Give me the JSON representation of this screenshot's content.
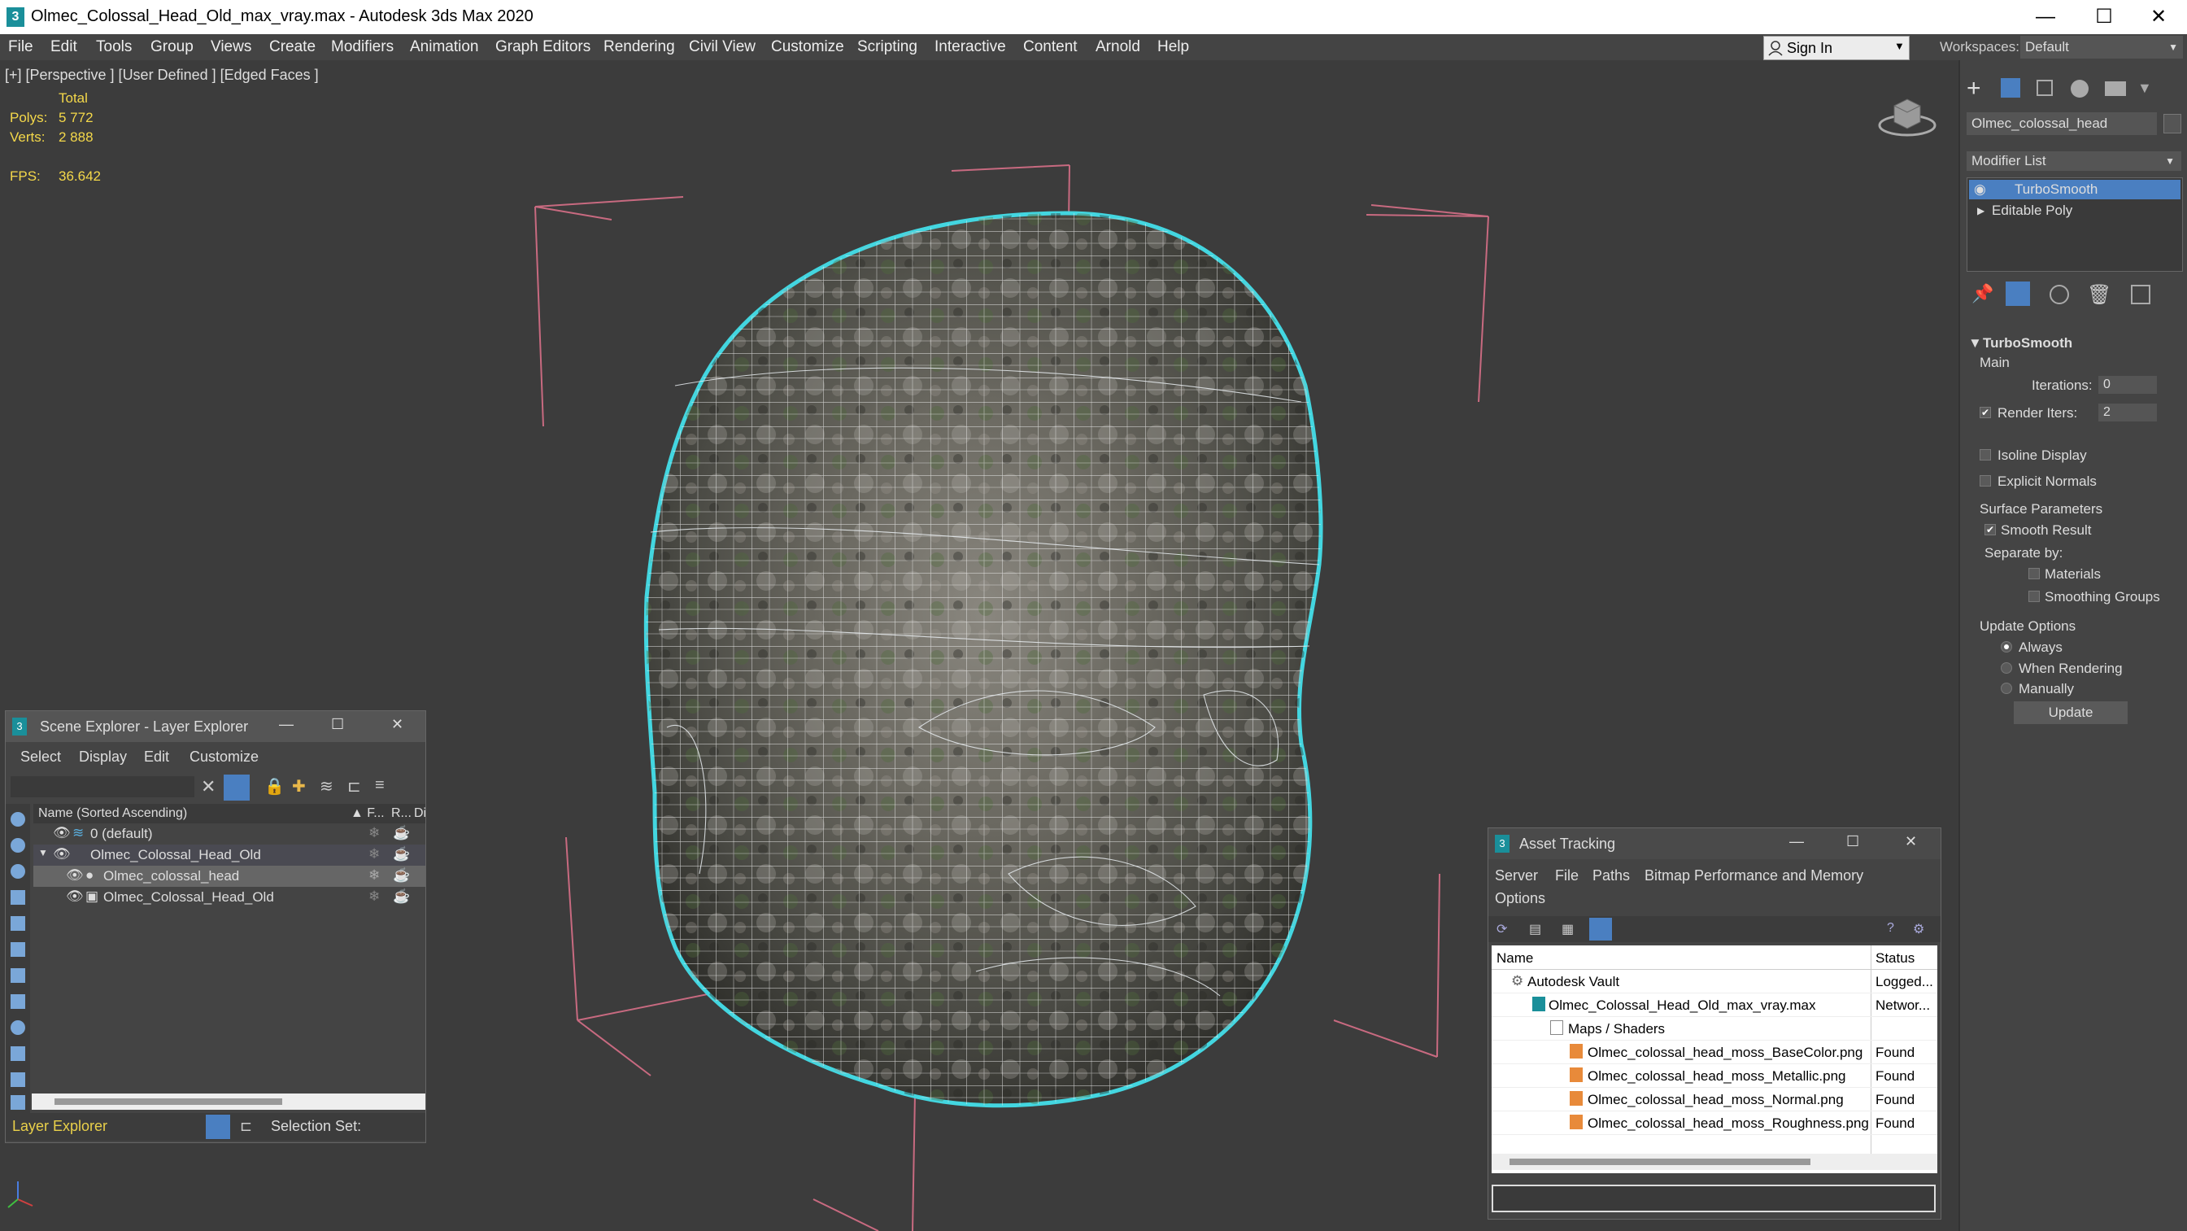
{
  "window": {
    "title": "Olmec_Colossal_Head_Old_max_vray.max - Autodesk 3ds Max 2020",
    "app_icon": "3",
    "minimize_glyph": "—",
    "maximize_glyph": "☐",
    "close_glyph": "✕"
  },
  "menu": [
    "File",
    "Edit",
    "Tools",
    "Group",
    "Views",
    "Create",
    "Modifiers",
    "Animation",
    "Graph Editors",
    "Rendering",
    "Civil View",
    "Customize",
    "Scripting",
    "Interactive",
    "Content",
    "Arnold",
    "Help"
  ],
  "signin": {
    "label": "Sign In"
  },
  "workspaces": {
    "label": "Workspaces:",
    "value": "Default"
  },
  "viewport": {
    "label": "[+] [Perspective ] [User Defined ] [Edged Faces ]",
    "stats": {
      "total_label": "Total",
      "polys_label": "Polys:",
      "polys_value": "5 772",
      "verts_label": "Verts:",
      "verts_value": "2 888",
      "fps_label": "FPS:",
      "fps_value": "36.642"
    }
  },
  "command_panel": {
    "object_name": "Olmec_colossal_head",
    "modifier_list_label": "Modifier List",
    "stack": [
      "TurboSmooth",
      "Editable Poly"
    ],
    "rollout_title": "TurboSmooth",
    "main_label": "Main",
    "iterations_label": "Iterations:",
    "iterations_value": "0",
    "render_iters_label": "Render Iters:",
    "render_iters_value": "2",
    "isoline_label": "Isoline Display",
    "explicit_normals_label": "Explicit Normals",
    "surface_params_label": "Surface Parameters",
    "smooth_result_label": "Smooth Result",
    "separate_by_label": "Separate by:",
    "materials_label": "Materials",
    "smoothing_groups_label": "Smoothing Groups",
    "update_options_label": "Update Options",
    "always_label": "Always",
    "when_rendering_label": "When Rendering",
    "manually_label": "Manually",
    "update_button": "Update",
    "selection_color": "#4a7fc1"
  },
  "scene_explorer": {
    "title": "Scene Explorer - Layer Explorer",
    "menus": [
      "Select",
      "Display",
      "Edit",
      "Customize"
    ],
    "col_name": "Name (Sorted Ascending)",
    "col_f": "▲ F...",
    "col_r": "R...",
    "col_d": "Di",
    "rows": [
      "0 (default)",
      "Olmec_Colossal_Head_Old",
      "Olmec_colossal_head",
      "Olmec_Colossal_Head_Old"
    ],
    "footer_dropdown": "Layer Explorer",
    "selection_set_label": "Selection Set:"
  },
  "asset_tracking": {
    "title": "Asset Tracking",
    "menus": [
      "Server",
      "File",
      "Paths",
      "Bitmap Performance and Memory"
    ],
    "menu_options": "Options",
    "col_name": "Name",
    "col_status": "Status",
    "rows": [
      {
        "name": "Autodesk Vault",
        "status": "Logged..."
      },
      {
        "name": "Olmec_Colossal_Head_Old_max_vray.max",
        "status": "Networ..."
      },
      {
        "name": "Maps / Shaders",
        "status": ""
      },
      {
        "name": "Olmec_colossal_head_moss_BaseColor.png",
        "status": "Found"
      },
      {
        "name": "Olmec_colossal_head_moss_Metallic.png",
        "status": "Found"
      },
      {
        "name": "Olmec_colossal_head_moss_Normal.png",
        "status": "Found"
      },
      {
        "name": "Olmec_colossal_head_moss_Roughness.png",
        "status": "Found"
      }
    ]
  }
}
